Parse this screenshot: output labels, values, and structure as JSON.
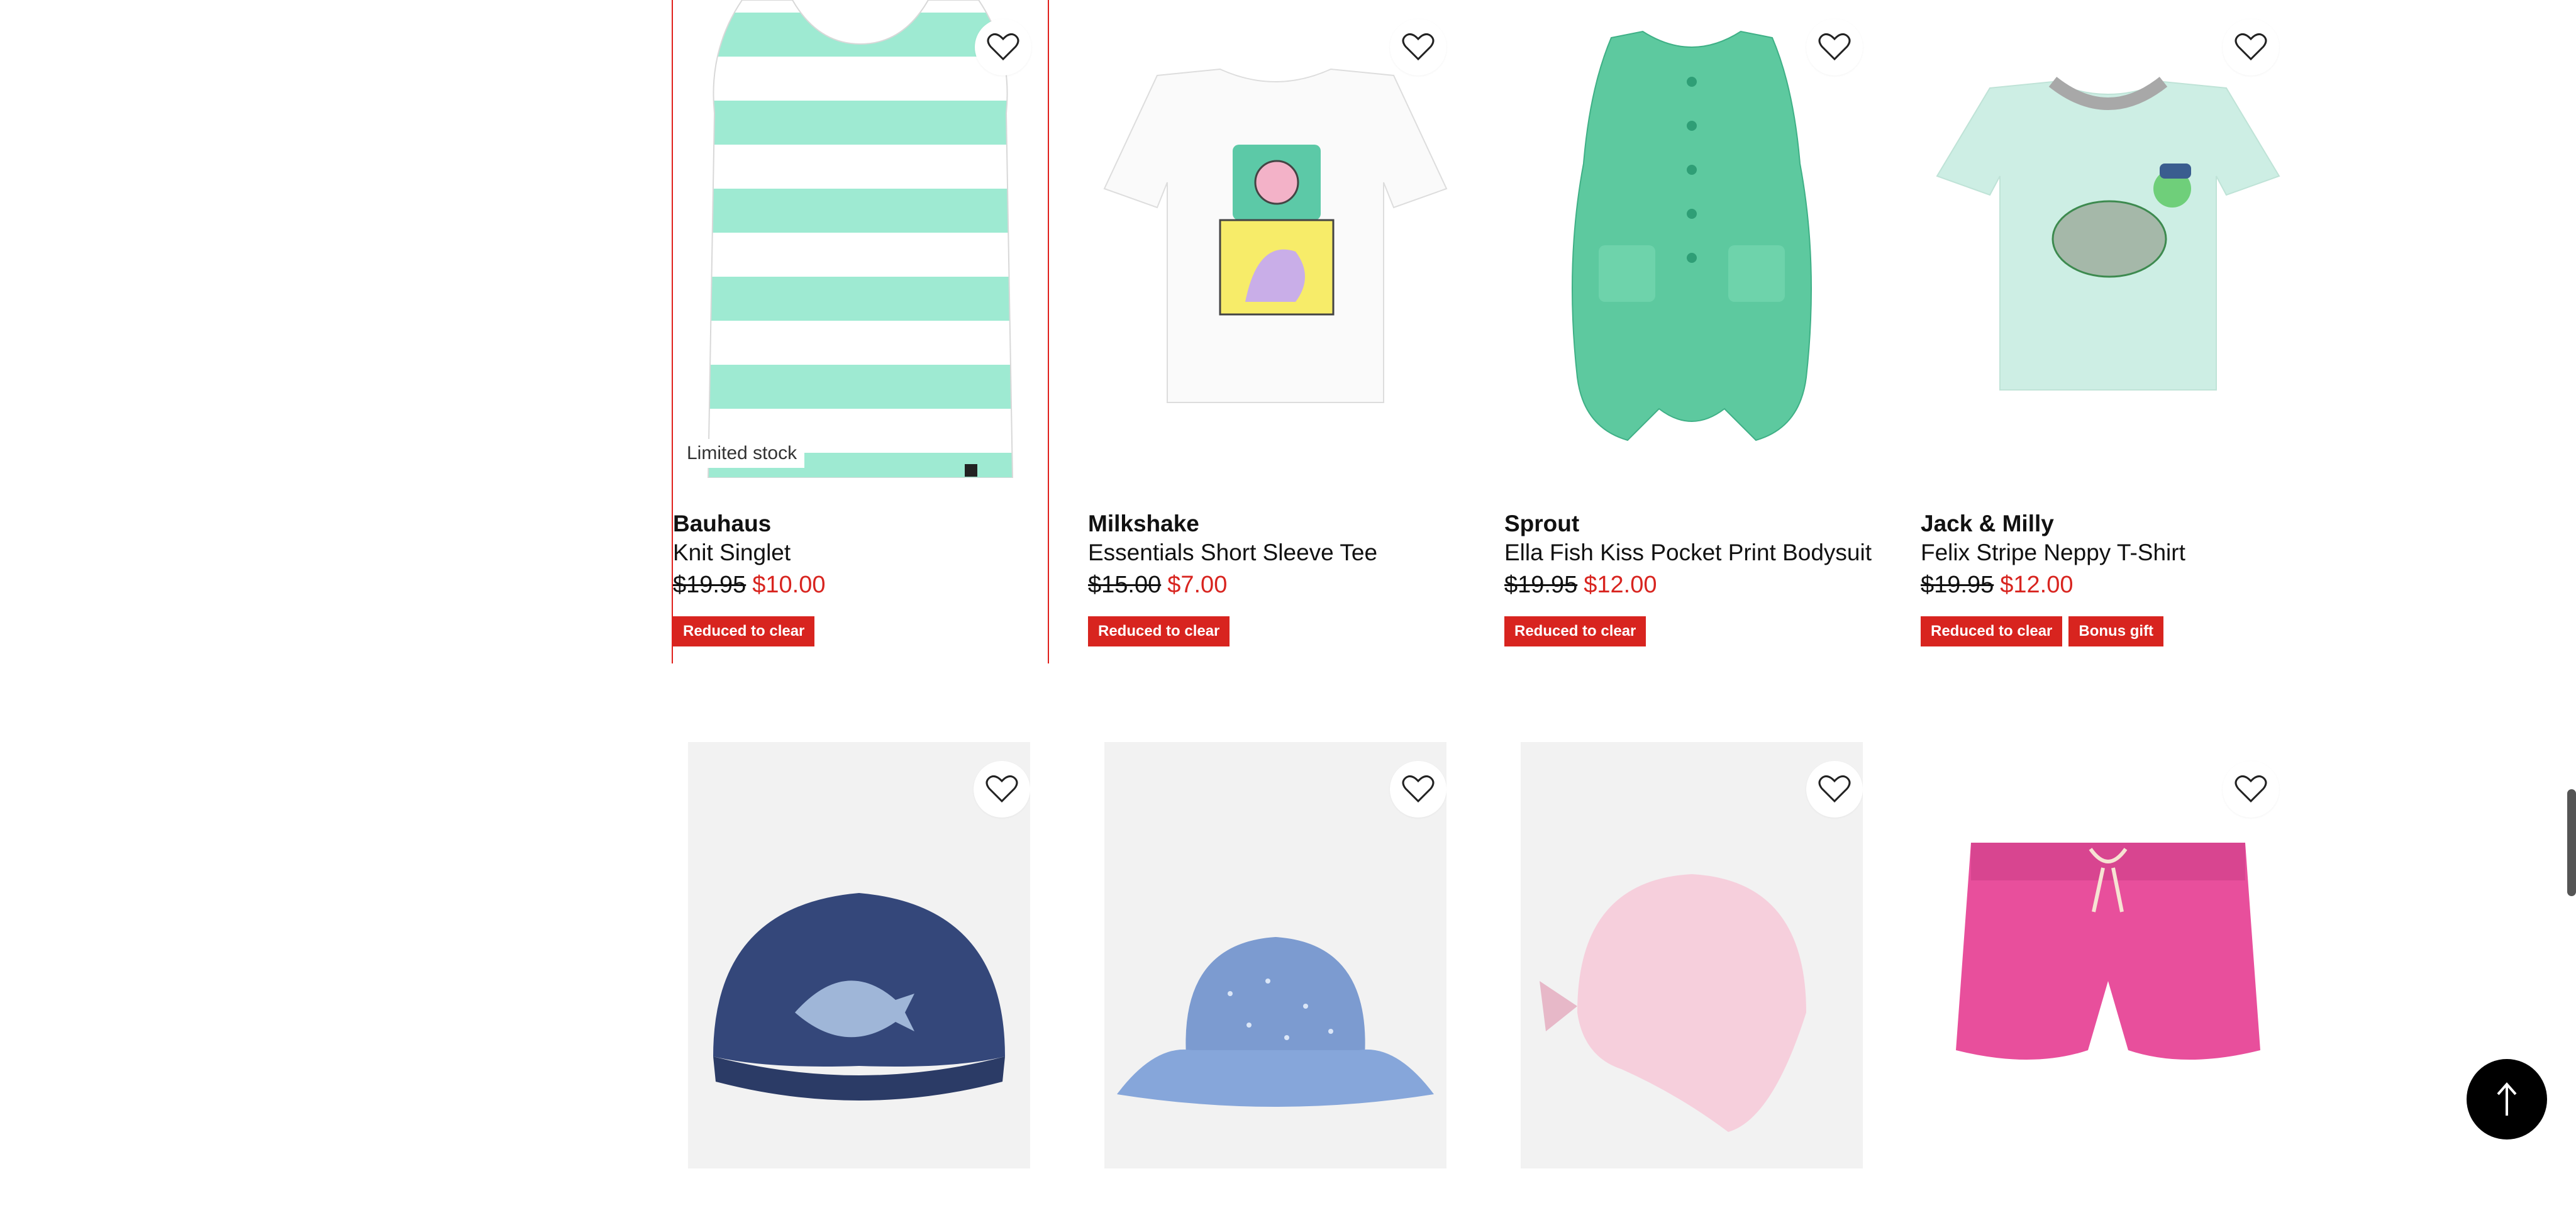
{
  "colors": {
    "sale_red": "#d8241f",
    "selected_border": "#e0201b",
    "text": "#111111"
  },
  "products": [
    {
      "brand": "Bauhaus",
      "name": "Knit Singlet",
      "was": "$19.95",
      "now": "$10.00",
      "stock_label": "Limited stock",
      "badges": [
        "Reduced to clear"
      ],
      "image": "mint-white-striped-singlet"
    },
    {
      "brand": "Milkshake",
      "name": "Essentials Short Sleeve Tee",
      "was": "$15.00",
      "now": "$7.00",
      "badges": [
        "Reduced to clear"
      ],
      "image": "white-tee-camera-print"
    },
    {
      "brand": "Sprout",
      "name": "Ella Fish Kiss Pocket Print Bodysuit",
      "was": "$19.95",
      "now": "$12.00",
      "badges": [
        "Reduced to clear"
      ],
      "image": "green-bodysuit"
    },
    {
      "brand": "Jack & Milly",
      "name": "Felix Stripe Neppy T-Shirt",
      "was": "$19.95",
      "now": "$12.00",
      "badges": [
        "Reduced to clear",
        "Bonus gift"
      ],
      "image": "mint-tee-turtle"
    }
  ],
  "row2_images": [
    "denim-cap-shark",
    "blue-bucket-hat",
    "pink-legionnaire-hat",
    "pink-shorts"
  ],
  "icons": {
    "wishlist": "heart-outline-icon",
    "back_to_top": "arrow-up-icon"
  }
}
